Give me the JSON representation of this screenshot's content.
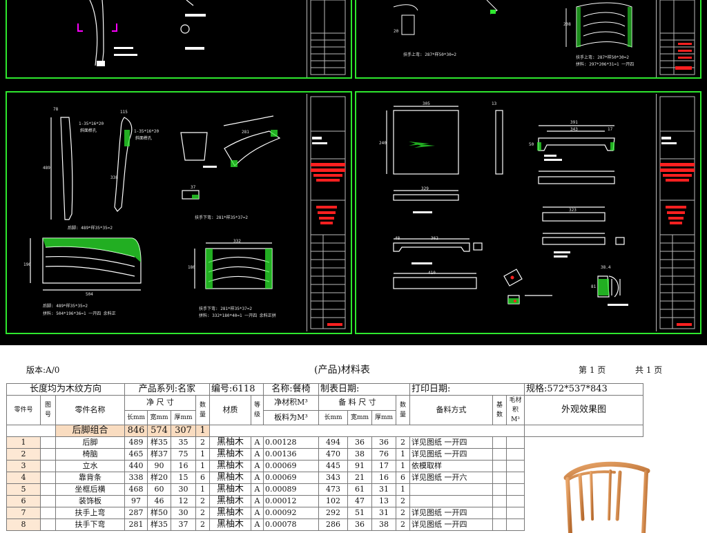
{
  "cad": {
    "labels": {
      "back_leg": "后脚: 489*样35*35=2",
      "back_leg_part1": "后脚: 489*样35*35=2",
      "back_leg_part2": "拼料: 504*196*36=1  一开四   余料正",
      "armrest_lower": "扶手下弯: 281*样35*37=2",
      "armrest_lower_part1": "扶手下弯: 281*样35*37=2",
      "armrest_lower_part2": "拼料: 332*180*40=1   一开四   余料正拼",
      "armrest_upper": "扶手上弯: 287*样50*30=2",
      "armrest_upper_right": "扶手上弯: 287*样50*30=2",
      "armrest_upper_right2": "拼料: 297*206*31=1   一开四",
      "mortise1": "1-35*16*20",
      "mortise1b": "斜面榫孔",
      "mortise2": "1-35*16*20",
      "mortise2b": "斜面榫孔"
    },
    "dims": {
      "d78": "78",
      "d35": "35",
      "d115": "115",
      "d489": "489",
      "d338": "338",
      "d196": "196",
      "d281": "281",
      "d37": "37",
      "d332": "332",
      "d180": "180",
      "d504": "504",
      "d13": "13",
      "d305": "305",
      "d329": "329",
      "d240": "240",
      "d391": "391",
      "d343": "343",
      "d17": "17",
      "d50": "50",
      "d323": "323",
      "d48": "48",
      "d362": "362",
      "d410": "410",
      "d38_4": "38.4",
      "d71": "71",
      "d81": "81",
      "d25": "25",
      "d32": "32",
      "d208": "208",
      "d20": "20"
    }
  },
  "sheet": {
    "version": "版本:A/0",
    "title": "(产品)材料表",
    "page": "第  1  页",
    "total": "共  1  页",
    "head": {
      "grain": "长度均为木纹方向",
      "series": "产品系列:名家",
      "number": "编号:6118",
      "name": "名称:餐椅",
      "made_date": "制表日期:",
      "print_date": "打印日期:",
      "spec": "规格:572*537*843"
    },
    "cols": {
      "part_no": "零件号",
      "fig_no": "图号",
      "part_name": "零件名称",
      "net_size": "净  尺  寸",
      "len": "长mm",
      "wid": "宽mm",
      "thk": "厚mm",
      "qty": "数量",
      "material": "材质",
      "grade": "等级",
      "net_vol": "净材积M³",
      "board_vol": "板料为M³",
      "prep_size": "备  料  尺  寸",
      "len2": "长mm",
      "wid2": "宽mm",
      "thk2": "厚mm",
      "qty2": "数量",
      "prep_method": "备料方式",
      "base_qty": "基数",
      "rough_vol": "毛材积M³",
      "appearance": "外观效果图"
    },
    "group": {
      "name": "后脚组合",
      "len": "846",
      "wid": "574",
      "thk": "307",
      "qty": "1"
    },
    "rows": [
      {
        "no": "1",
        "name": "后脚",
        "len": "489",
        "wid": "样35",
        "thk": "35",
        "qty": "2",
        "mat": "黑柚木",
        "grade": "A",
        "vol": "0.00128",
        "l2": "494",
        "w2": "36",
        "t2": "36",
        "q2": "2",
        "method": "详见图纸  一开四"
      },
      {
        "no": "2",
        "name": "椅脑",
        "len": "465",
        "wid": "样37",
        "thk": "75",
        "qty": "1",
        "mat": "黑柚木",
        "grade": "A",
        "vol": "0.00136",
        "l2": "470",
        "w2": "38",
        "t2": "76",
        "q2": "1",
        "method": "详见图纸  一开四"
      },
      {
        "no": "3",
        "name": "立水",
        "len": "440",
        "wid": "90",
        "thk": "16",
        "qty": "1",
        "mat": "黑柚木",
        "grade": "A",
        "vol": "0.00069",
        "l2": "445",
        "w2": "91",
        "t2": "17",
        "q2": "1",
        "method": "依模取样"
      },
      {
        "no": "4",
        "name": "靠背条",
        "len": "338",
        "wid": "样20",
        "thk": "15",
        "qty": "6",
        "mat": "黑柚木",
        "grade": "A",
        "vol": "0.00069",
        "l2": "343",
        "w2": "21",
        "t2": "16",
        "q2": "6",
        "method": "详见图纸  一开六"
      },
      {
        "no": "5",
        "name": "坐框后横",
        "len": "468",
        "wid": "60",
        "thk": "30",
        "qty": "1",
        "mat": "黑柚木",
        "grade": "A",
        "vol": "0.00089",
        "l2": "473",
        "w2": "61",
        "t2": "31",
        "q2": "1",
        "method": ""
      },
      {
        "no": "6",
        "name": "装饰板",
        "len": "97",
        "wid": "46",
        "thk": "12",
        "qty": "2",
        "mat": "黑柚木",
        "grade": "A",
        "vol": "0.00012",
        "l2": "102",
        "w2": "47",
        "t2": "13",
        "q2": "2",
        "method": ""
      },
      {
        "no": "7",
        "name": "扶手上弯",
        "len": "287",
        "wid": "样50",
        "thk": "30",
        "qty": "2",
        "mat": "黑柚木",
        "grade": "A",
        "vol": "0.00092",
        "l2": "292",
        "w2": "51",
        "t2": "31",
        "q2": "2",
        "method": "详见图纸  一开四"
      },
      {
        "no": "8",
        "name": "扶手下弯",
        "len": "281",
        "wid": "样35",
        "thk": "37",
        "qty": "2",
        "mat": "黑柚木",
        "grade": "A",
        "vol": "0.00078",
        "l2": "286",
        "w2": "36",
        "t2": "38",
        "q2": "2",
        "method": "详见图纸  一开四"
      }
    ]
  },
  "colors": {
    "cad_bg": "#000000",
    "frame": "#2ee82e",
    "accent_red": "#ff2020",
    "group_row": "#f9dcc0"
  }
}
